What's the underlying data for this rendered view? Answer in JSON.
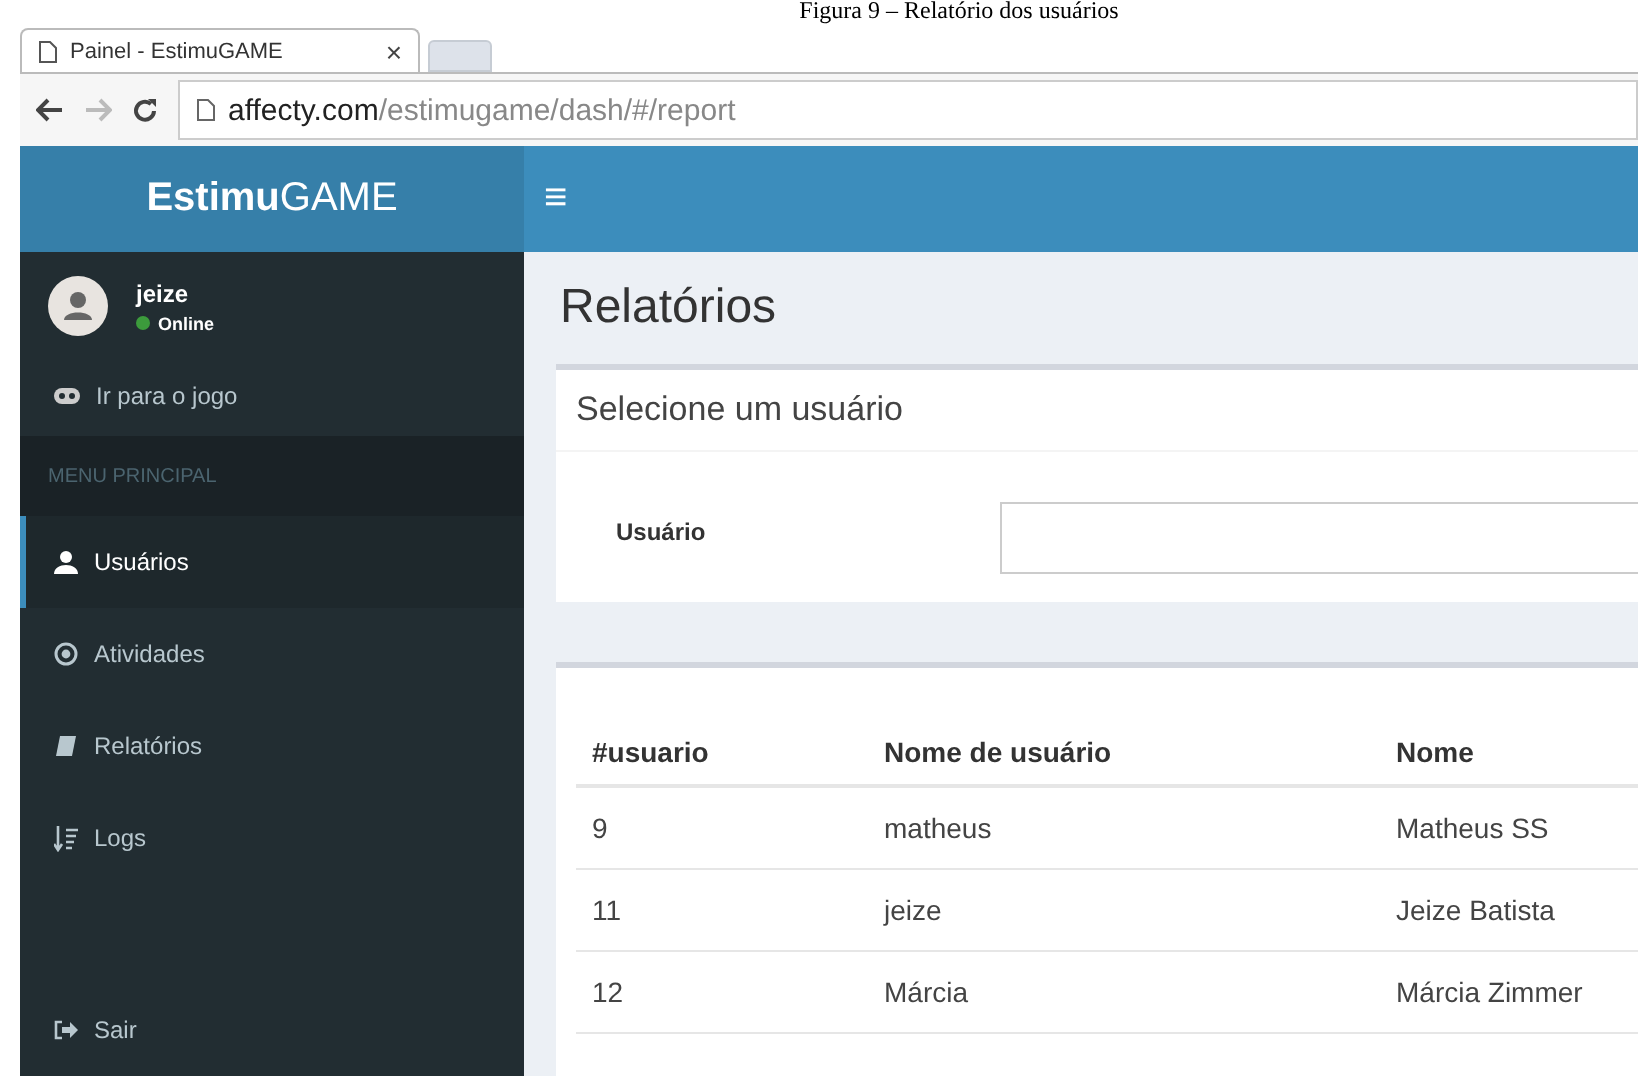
{
  "caption": "Figura 9 – Relatório dos usuários",
  "browser": {
    "tab_title": "Painel - EstimuGAME",
    "tab_close": "×",
    "url_host": "affecty.com",
    "url_path": "/estimugame/dash/#/report"
  },
  "app": {
    "brand_bold": "Estimu",
    "brand_rest": "GAME",
    "menu_glyph": "≡"
  },
  "user": {
    "name": "jeize",
    "status": "Online"
  },
  "sidebar": {
    "top_link": "Ir para o jogo",
    "header": "MENU PRINCIPAL",
    "items": [
      {
        "label": "Usuários",
        "selected": true
      },
      {
        "label": "Atividades",
        "selected": false
      },
      {
        "label": "Relatórios",
        "selected": false
      },
      {
        "label": "Logs",
        "selected": false
      }
    ],
    "logout": "Sair"
  },
  "page_title": "Relatórios",
  "select_box": {
    "title": "Selecione um usuário",
    "field_label": "Usuário"
  },
  "table": {
    "columns": [
      "#usuario",
      "Nome de usuário",
      "Nome"
    ],
    "rows": [
      [
        "9",
        "matheus",
        "Matheus SS"
      ],
      [
        "11",
        "jeize",
        "Jeize Batista"
      ],
      [
        "12",
        "Márcia",
        "Márcia Zimmer"
      ]
    ]
  }
}
